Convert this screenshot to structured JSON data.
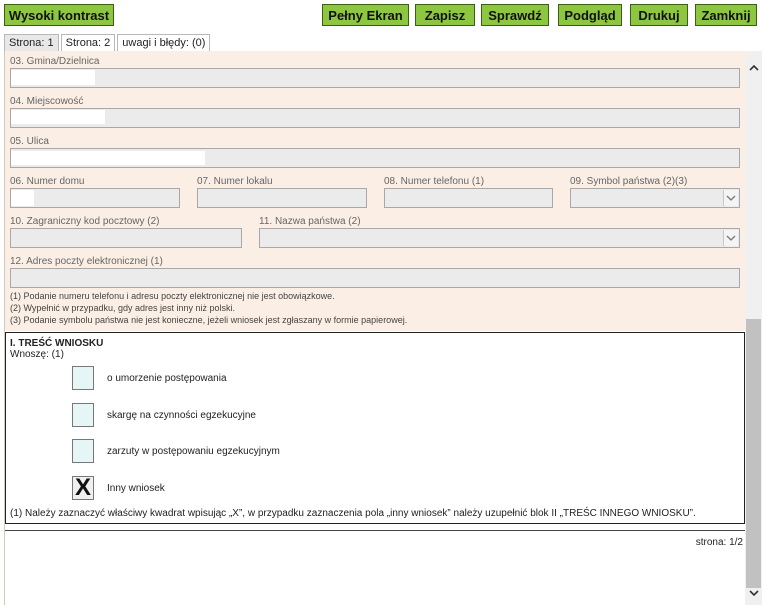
{
  "toolbar": {
    "high_contrast": "Wysoki kontrast",
    "fullscreen": "Pełny Ekran",
    "save": "Zapisz",
    "check": "Sprawdź",
    "preview": "Podgląd",
    "print": "Drukuj",
    "close": "Zamknij",
    "accent_color": "#8dc641"
  },
  "tabs": [
    {
      "label": "Strona: 1",
      "active": true
    },
    {
      "label": "Strona: 2",
      "active": false
    },
    {
      "label": "uwagi i błędy: (0)",
      "active": false
    }
  ],
  "form": {
    "background_color": "#fbeee4",
    "field_color": "#ebebeb",
    "fields": {
      "gmina": {
        "label": "03. Gmina/Dzielnica",
        "value": ""
      },
      "miejscowosc": {
        "label": "04. Miejscowość",
        "value": ""
      },
      "ulica": {
        "label": "05. Ulica",
        "value": ""
      },
      "numer_domu": {
        "label": "06. Numer domu",
        "value": ""
      },
      "numer_lokalu": {
        "label": "07. Numer lokalu",
        "value": ""
      },
      "numer_telefonu": {
        "label": "08. Numer telefonu (1)",
        "value": ""
      },
      "symbol_panstwa": {
        "label": "09. Symbol państwa (2)(3)",
        "value": ""
      },
      "kod_pocztowy": {
        "label": "10. Zagraniczny kod pocztowy (2)",
        "value": ""
      },
      "nazwa_panstwa": {
        "label": "11. Nazwa państwa (2)",
        "value": ""
      },
      "email": {
        "label": "12. Adres poczty elektronicznej (1)",
        "value": ""
      }
    },
    "notes": [
      "(1)  Podanie numeru telefonu i adresu poczty elektronicznej nie jest obowiązkowe.",
      "(2)  Wypełnić w przypadku, gdy adres jest inny niż polski.",
      "(3)  Podanie symbolu państwa nie jest konieczne, jeżeli wniosek jest zgłaszany w formie papierowej."
    ]
  },
  "section": {
    "title": "I. TREŚĆ WNIOSKU",
    "subtitle": "Wnoszę: (1)",
    "options": [
      {
        "label": "o umorzenie postępowania",
        "checked": false,
        "mark": ""
      },
      {
        "label": "skargę na czynności egzekucyjne",
        "checked": false,
        "mark": ""
      },
      {
        "label": "zarzuty w postępowaniu egzekucyjnym",
        "checked": false,
        "mark": ""
      },
      {
        "label": "Inny wniosek",
        "checked": true,
        "mark": "X"
      }
    ],
    "footnote": "(1) Należy zaznaczyć właściwy kwadrat wpisując „X”, w przypadku zaznaczenia pola „inny wniosek” należy uzupełnić blok II „TREŚC INNEGO WNIOSKU”."
  },
  "page_indicator": "strona: 1/2",
  "icons": {
    "dropdown": "chevron-down-icon",
    "scroll_up": "scroll-up-arrow-icon",
    "scroll_down": "scroll-down-arrow-icon"
  }
}
